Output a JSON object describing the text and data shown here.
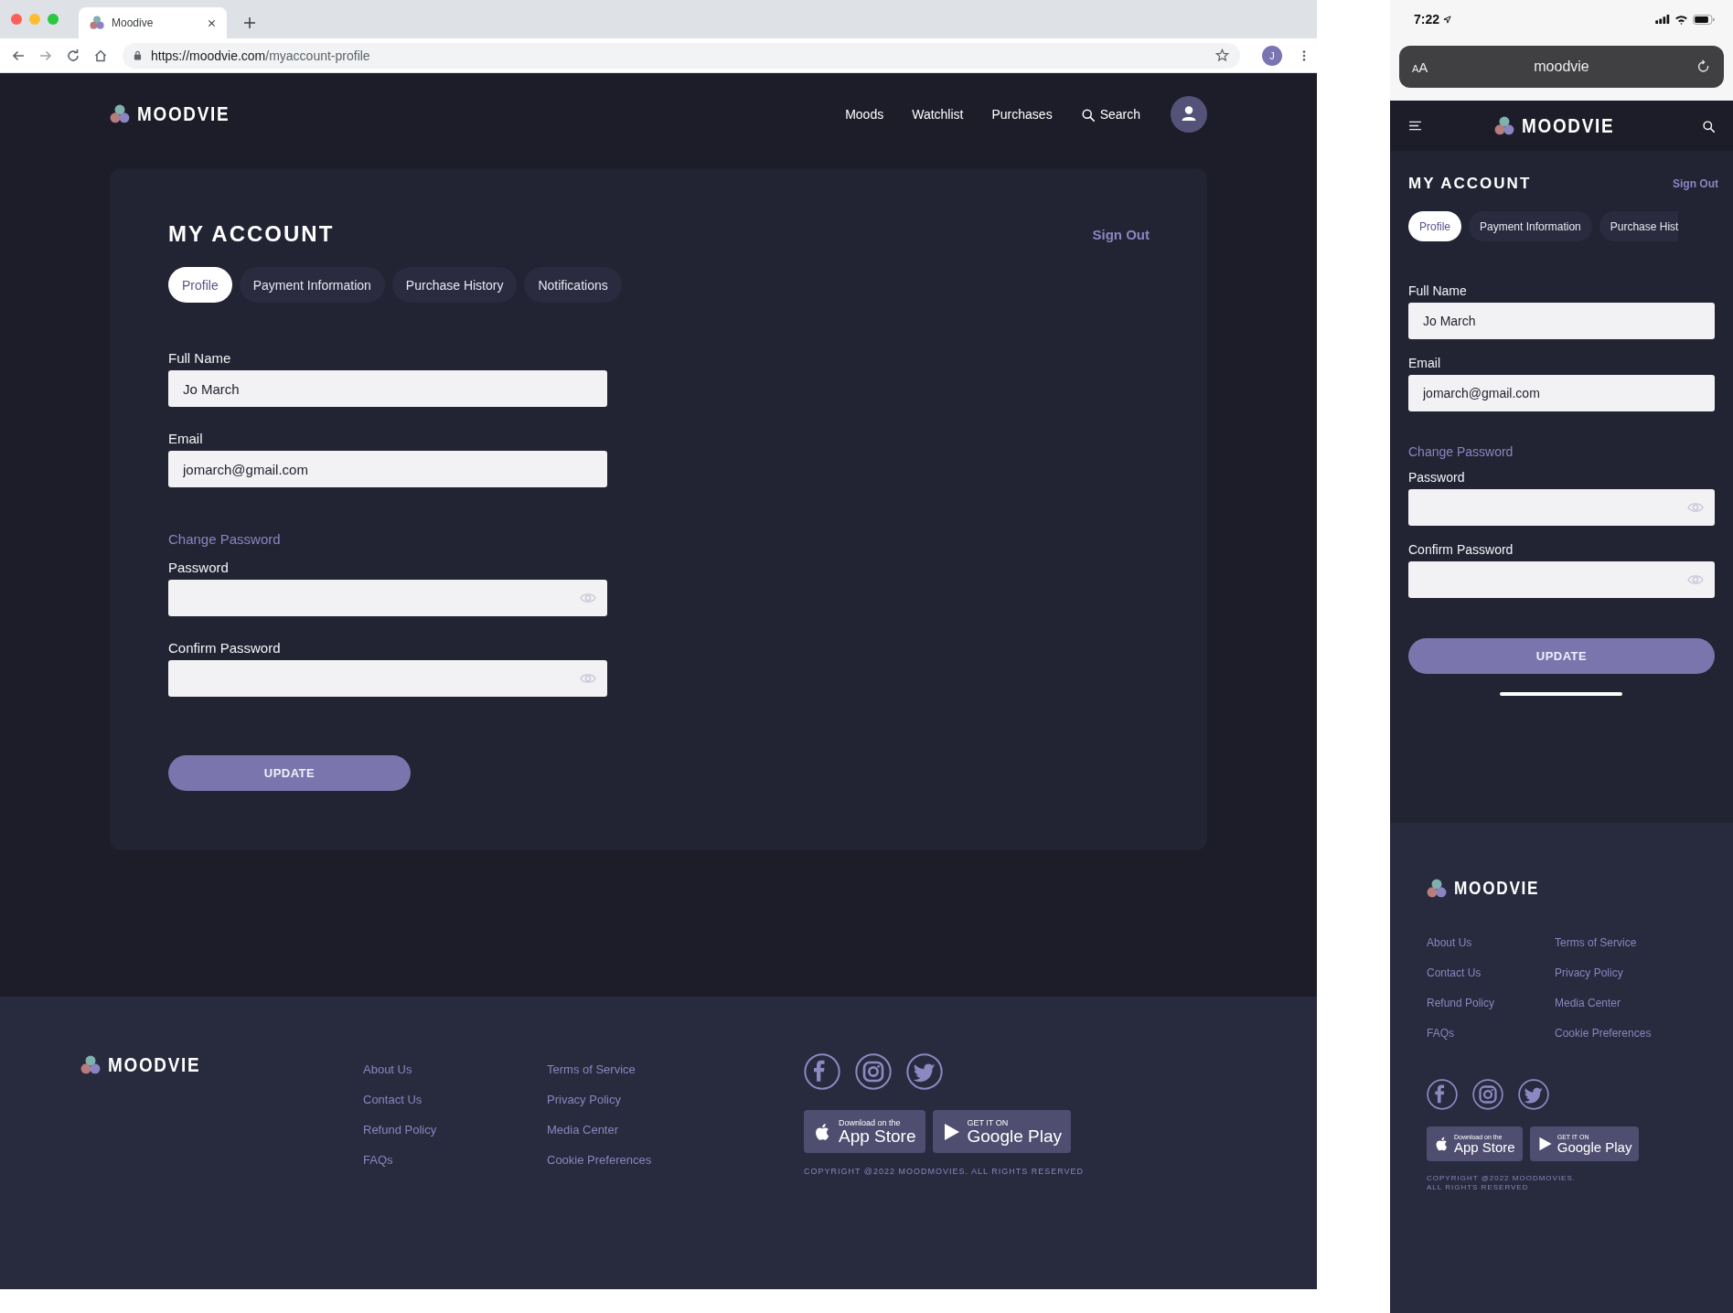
{
  "browser": {
    "tab_title": "Moodive",
    "url_host": "https://moodvie.com",
    "url_path": "/myaccount-profile",
    "profile_initial": "J"
  },
  "desktop": {
    "header": {
      "brand": "MOODVIE",
      "nav_links": [
        "Moods",
        "Watchlist",
        "Purchases"
      ],
      "search_label": "Search"
    },
    "account": {
      "title": "MY ACCOUNT",
      "sign_out": "Sign Out",
      "tabs": [
        {
          "label": "Profile",
          "selected": true
        },
        {
          "label": "Payment Information",
          "selected": false
        },
        {
          "label": "Purchase History",
          "selected": false
        },
        {
          "label": "Notifications",
          "selected": false
        }
      ],
      "profile_fields": [
        {
          "label": "Full Name",
          "value": "Jo March",
          "kind": "text"
        },
        {
          "label": "Email",
          "value": "jomarch@gmail.com",
          "kind": "text"
        }
      ],
      "password_heading": "Change Password",
      "password_fields": [
        {
          "label": "Password",
          "kind": "password"
        },
        {
          "label": "Confirm Password",
          "kind": "password"
        }
      ],
      "submit": "UPDATE"
    },
    "footer": {
      "brand": "MOODVIE",
      "link_columns": [
        [
          "About Us",
          "Contact Us",
          "Refund Policy",
          "FAQs"
        ],
        [
          "Terms of Service",
          "Privacy Policy",
          "Media Center",
          "Cookie Preferences"
        ]
      ],
      "badges": [
        {
          "kind": "app_store",
          "caption": "Download on the",
          "store": "App Store"
        },
        {
          "kind": "google_play",
          "caption": "GET IT ON",
          "store": "Google Play"
        }
      ],
      "copyright_lines": [
        "COPYRIGHT @2022 MOODMOVIES. ALL RIGHTS RESERVED"
      ]
    }
  },
  "mobile": {
    "status_bar": {
      "time": "7:22"
    },
    "address_bar": {
      "text_size_label": "AA",
      "site": "moodvie"
    },
    "header": {
      "brand": "MOODVIE"
    },
    "account": {
      "title": "MY ACCOUNT",
      "sign_out": "Sign Out",
      "tabs": [
        {
          "label": "Profile",
          "selected": true
        },
        {
          "label": "Payment Information",
          "selected": false
        },
        {
          "label": "Purchase Hist",
          "selected": false
        }
      ],
      "profile_fields": [
        {
          "label": "Full Name",
          "value": "Jo March",
          "kind": "text"
        },
        {
          "label": "Email",
          "value": "jomarch@gmail.com",
          "kind": "text"
        }
      ],
      "password_heading": "Change Password",
      "password_fields": [
        {
          "label": "Password",
          "kind": "password"
        },
        {
          "label": "Confirm Password",
          "kind": "password"
        }
      ],
      "submit": "UPDATE"
    },
    "footer": {
      "brand": "MOODVIE",
      "link_columns": [
        [
          "About Us",
          "Contact Us",
          "Refund Policy",
          "FAQs"
        ],
        [
          "Terms of Service",
          "Privacy Policy",
          "Media Center",
          "Cookie Preferences"
        ]
      ],
      "badges": [
        {
          "kind": "app_store",
          "caption": "Download on the",
          "store": "App Store"
        },
        {
          "kind": "google_play",
          "caption": "GET IT ON",
          "store": "Google Play"
        }
      ],
      "copyright_lines": [
        "COPYRIGHT @2022 MOODMOVIES.",
        "ALL RIGHTS RESERVED"
      ]
    }
  }
}
